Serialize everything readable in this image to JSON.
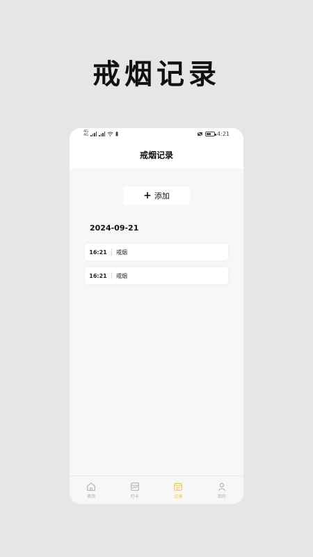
{
  "hero": {
    "title": "戒烟记录"
  },
  "status_bar": {
    "time": "4:21",
    "sim1": "4G",
    "sim2": "4G"
  },
  "nav": {
    "title": "戒烟记录"
  },
  "add_button": {
    "label": "添加",
    "icon": "plus-icon"
  },
  "records": {
    "date": "2024-09-21",
    "items": [
      {
        "time": "16:21",
        "label": "戒烟"
      },
      {
        "time": "16:21",
        "label": "戒烟"
      }
    ]
  },
  "tabs": [
    {
      "label": "首页",
      "icon": "home-icon",
      "active": false
    },
    {
      "label": "打卡",
      "icon": "checkin-icon",
      "active": false
    },
    {
      "label": "记录",
      "icon": "calendar-icon",
      "active": true
    },
    {
      "label": "我的",
      "icon": "user-icon",
      "active": false
    }
  ],
  "colors": {
    "accent": "#f5c53b",
    "background": "#e6e6e6",
    "phone_bg": "#f7f7f7"
  }
}
